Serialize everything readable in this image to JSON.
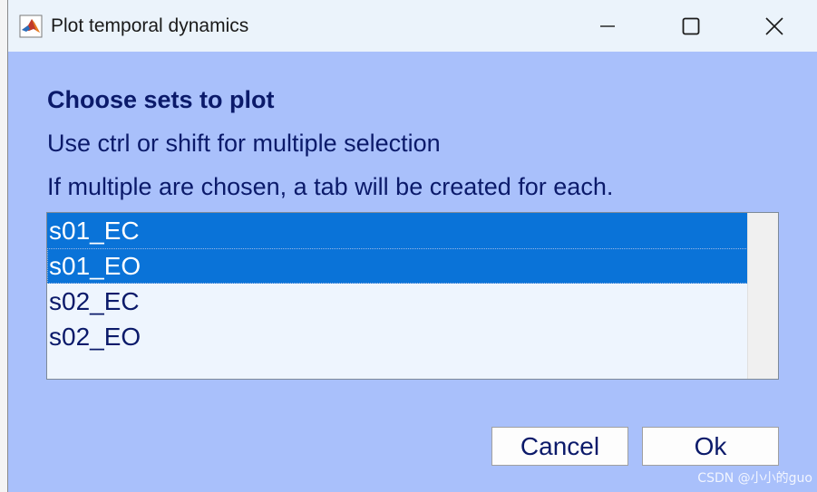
{
  "window": {
    "title": "Plot temporal dynamics",
    "app_icon": "matlab-icon",
    "controls": [
      "minimize-icon",
      "maximize-icon",
      "close-icon"
    ]
  },
  "dialog": {
    "heading": "Choose sets to plot",
    "instruction1": "Use ctrl or shift for multiple selection",
    "instruction2": "If multiple are chosen, a tab will be created for each."
  },
  "list": {
    "items": [
      {
        "label": "s01_EC",
        "selected": true
      },
      {
        "label": "s01_EO",
        "selected": true
      },
      {
        "label": "s02_EC",
        "selected": false
      },
      {
        "label": "s02_EO",
        "selected": false
      }
    ]
  },
  "buttons": {
    "cancel_label": "Cancel",
    "ok_label": "Ok"
  },
  "watermark": "CSDN @小小的guo",
  "colors": {
    "dialog_bg": "#a9c0fb",
    "text": "#0b1a6a",
    "selection": "#0a73d8"
  }
}
